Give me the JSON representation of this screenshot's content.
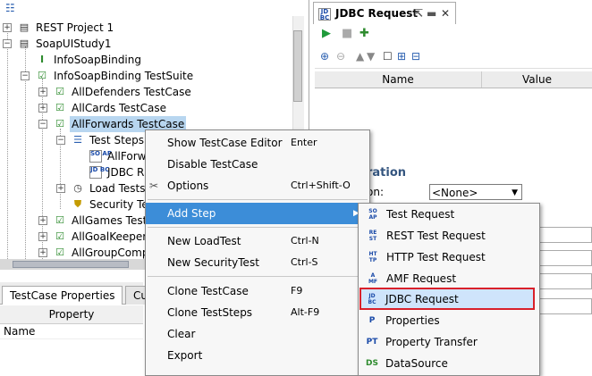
{
  "nav": {
    "icon": "tree-options-icon"
  },
  "tree": {
    "items": [
      {
        "label": "REST Project 1"
      },
      {
        "label": "SoapUIStudy1"
      },
      {
        "label": "InfoSoapBinding"
      },
      {
        "label": "InfoSoapBinding TestSuite"
      },
      {
        "label": "AllDefenders TestCase"
      },
      {
        "label": "AllCards TestCase"
      },
      {
        "label": "AllForwards TestCase"
      },
      {
        "label": "Test Steps"
      },
      {
        "label": "AllForw"
      },
      {
        "label": "JDBC R"
      },
      {
        "label": "Load Tests"
      },
      {
        "label": "Security Te"
      },
      {
        "label": "AllGames Test"
      },
      {
        "label": "AllGoalKeeper"
      },
      {
        "label": "AllGroupComp"
      }
    ]
  },
  "bottom": {
    "tabs": [
      "TestCase Properties",
      "Cu"
    ],
    "property_header": "Property",
    "rows": [
      "Name"
    ]
  },
  "jdbc": {
    "tab_title": "JDBC Request",
    "columns": [
      "Name",
      "Value"
    ],
    "config_label": "ration",
    "conn_label": "on:",
    "conn_value": "<None>"
  },
  "menu": {
    "items": [
      {
        "label": "Show TestCase Editor",
        "shortcut": "Enter"
      },
      {
        "label": "Disable TestCase",
        "shortcut": ""
      },
      {
        "label": "Options",
        "shortcut": "Ctrl+Shift-O"
      },
      {
        "label": "Add Step",
        "shortcut": ""
      },
      {
        "label": "New LoadTest",
        "shortcut": "Ctrl-N"
      },
      {
        "label": "New SecurityTest",
        "shortcut": "Ctrl-S"
      },
      {
        "label": "Clone TestCase",
        "shortcut": "F9"
      },
      {
        "label": "Clone TestSteps",
        "shortcut": "Alt-F9"
      },
      {
        "label": "Clear",
        "shortcut": ""
      },
      {
        "label": "Export",
        "shortcut": ""
      }
    ]
  },
  "submenu": {
    "items": [
      {
        "label": "Test Request",
        "icon": "SO AP"
      },
      {
        "label": "REST Test Request",
        "icon": "RE ST"
      },
      {
        "label": "HTTP Test Request",
        "icon": "HT TP"
      },
      {
        "label": "AMF Request",
        "icon": "A MF"
      },
      {
        "label": "JDBC Request",
        "icon": "JD BC"
      },
      {
        "label": "Properties",
        "icon": "P"
      },
      {
        "label": "Property Transfer",
        "icon": "PT"
      },
      {
        "label": "DataSource",
        "icon": "DS"
      }
    ]
  },
  "colors": {
    "highlight": "#3c8dd8",
    "selection": "#b8d6f0",
    "outline": "#d9202a"
  }
}
